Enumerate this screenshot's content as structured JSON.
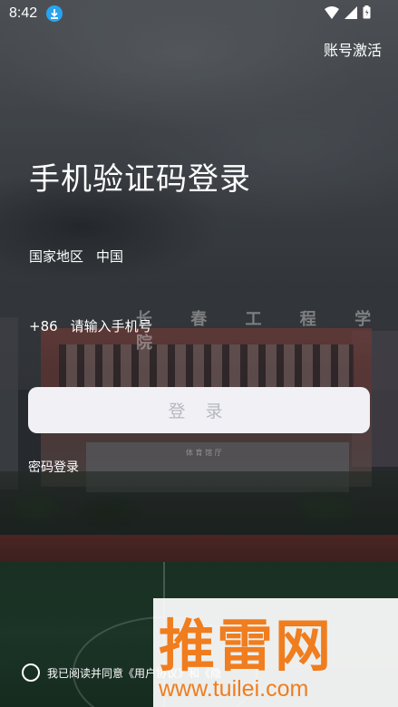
{
  "status_bar": {
    "time": "8:42",
    "icons": [
      "download-icon",
      "wifi-icon",
      "signal-icon",
      "battery-icon"
    ]
  },
  "header": {
    "activate_label": "账号激活"
  },
  "main": {
    "title": "手机验证码登录",
    "region_label": "国家地区",
    "region_value": "中国",
    "country_code": "+86",
    "phone_placeholder": "请输入手机号",
    "login_label": "登 录",
    "password_login_label": "密码登录"
  },
  "agreement": {
    "text": "我已阅读并同意《用户协议》和《隐"
  },
  "background_sign": {
    "text": "长 春 工 程 学 院",
    "gym_text": "体 育 馆 厅"
  },
  "watermark": {
    "brand": "推雷网",
    "url": "www.tuilei.com"
  },
  "colors": {
    "login_button_bg": "#f0f0f5",
    "login_button_text": "#b7b7c0",
    "download_badge": "#29a3f0",
    "watermark": "#f07d1e"
  }
}
